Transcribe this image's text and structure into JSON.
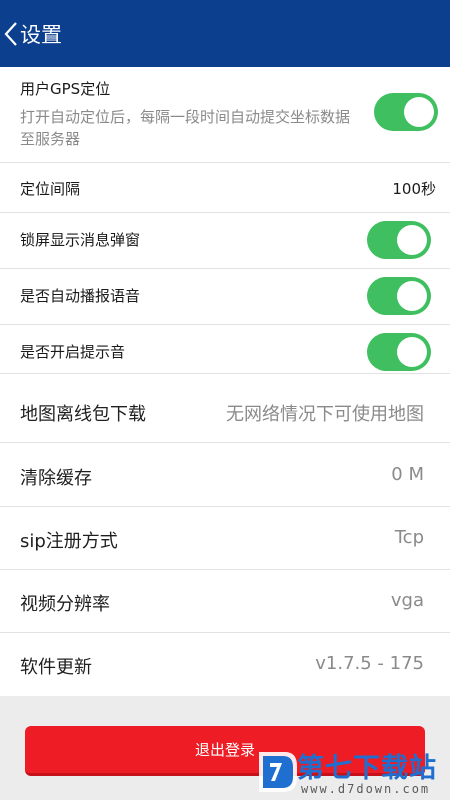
{
  "header": {
    "title": "设置"
  },
  "gps": {
    "title": "用户GPS定位",
    "desc": "打开自动定位后，每隔一段时间自动提交坐标数据至服务器",
    "enabled": true
  },
  "interval": {
    "label": "定位间隔",
    "value": "100秒"
  },
  "toggles": [
    {
      "label": "锁屏显示消息弹窗",
      "enabled": true
    },
    {
      "label": "是否自动播报语音",
      "enabled": true
    },
    {
      "label": "是否开启提示音",
      "enabled": true
    }
  ],
  "items": [
    {
      "label": "地图离线包下载",
      "value": "无网络情况下可使用地图"
    },
    {
      "label": "清除缓存",
      "value": "0 M"
    },
    {
      "label": "sip注册方式",
      "value": "Tcp"
    },
    {
      "label": "视频分辨率",
      "value": "vga"
    },
    {
      "label": "软件更新",
      "value": "v1.7.5 - 175"
    }
  ],
  "logout": {
    "label": "退出登录"
  },
  "watermark": {
    "title": "第七下载站",
    "url": "www.d7down.com"
  },
  "colors": {
    "header": "#0d3f8f",
    "toggle_on": "#3fbf60",
    "logout": "#ee1c24",
    "watermark": "#1e6fd0"
  }
}
